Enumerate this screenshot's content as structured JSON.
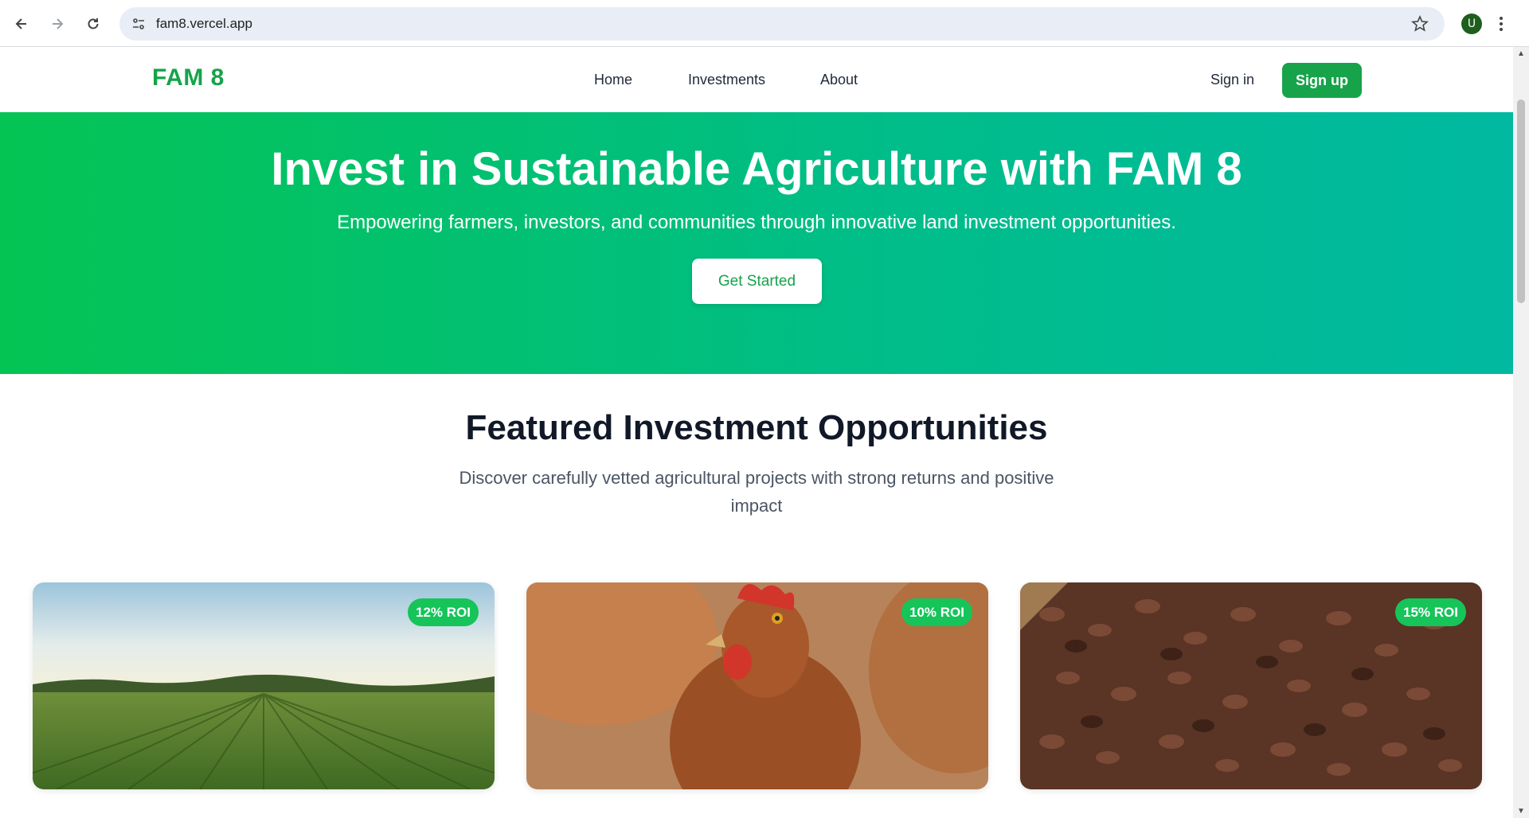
{
  "browser": {
    "url": "fam8.vercel.app",
    "avatar_letter": "U"
  },
  "header": {
    "logo": "FAM 8",
    "nav": [
      "Home",
      "Investments",
      "About"
    ],
    "signin": "Sign in",
    "signup": "Sign up"
  },
  "hero": {
    "title": "Invest in Sustainable Agriculture with FAM 8",
    "subtitle": "Empowering farmers, investors, and communities through innovative land investment opportunities.",
    "cta": "Get Started"
  },
  "featured": {
    "title": "Featured Investment Opportunities",
    "subtitle": "Discover carefully vetted agricultural projects with strong returns and positive impact",
    "cards": [
      {
        "roi": "12% ROI"
      },
      {
        "roi": "10% ROI"
      },
      {
        "roi": "15% ROI"
      }
    ]
  },
  "colors": {
    "brand": "#16a34a",
    "hero_start": "#04c454",
    "hero_end": "#00b9a0"
  }
}
